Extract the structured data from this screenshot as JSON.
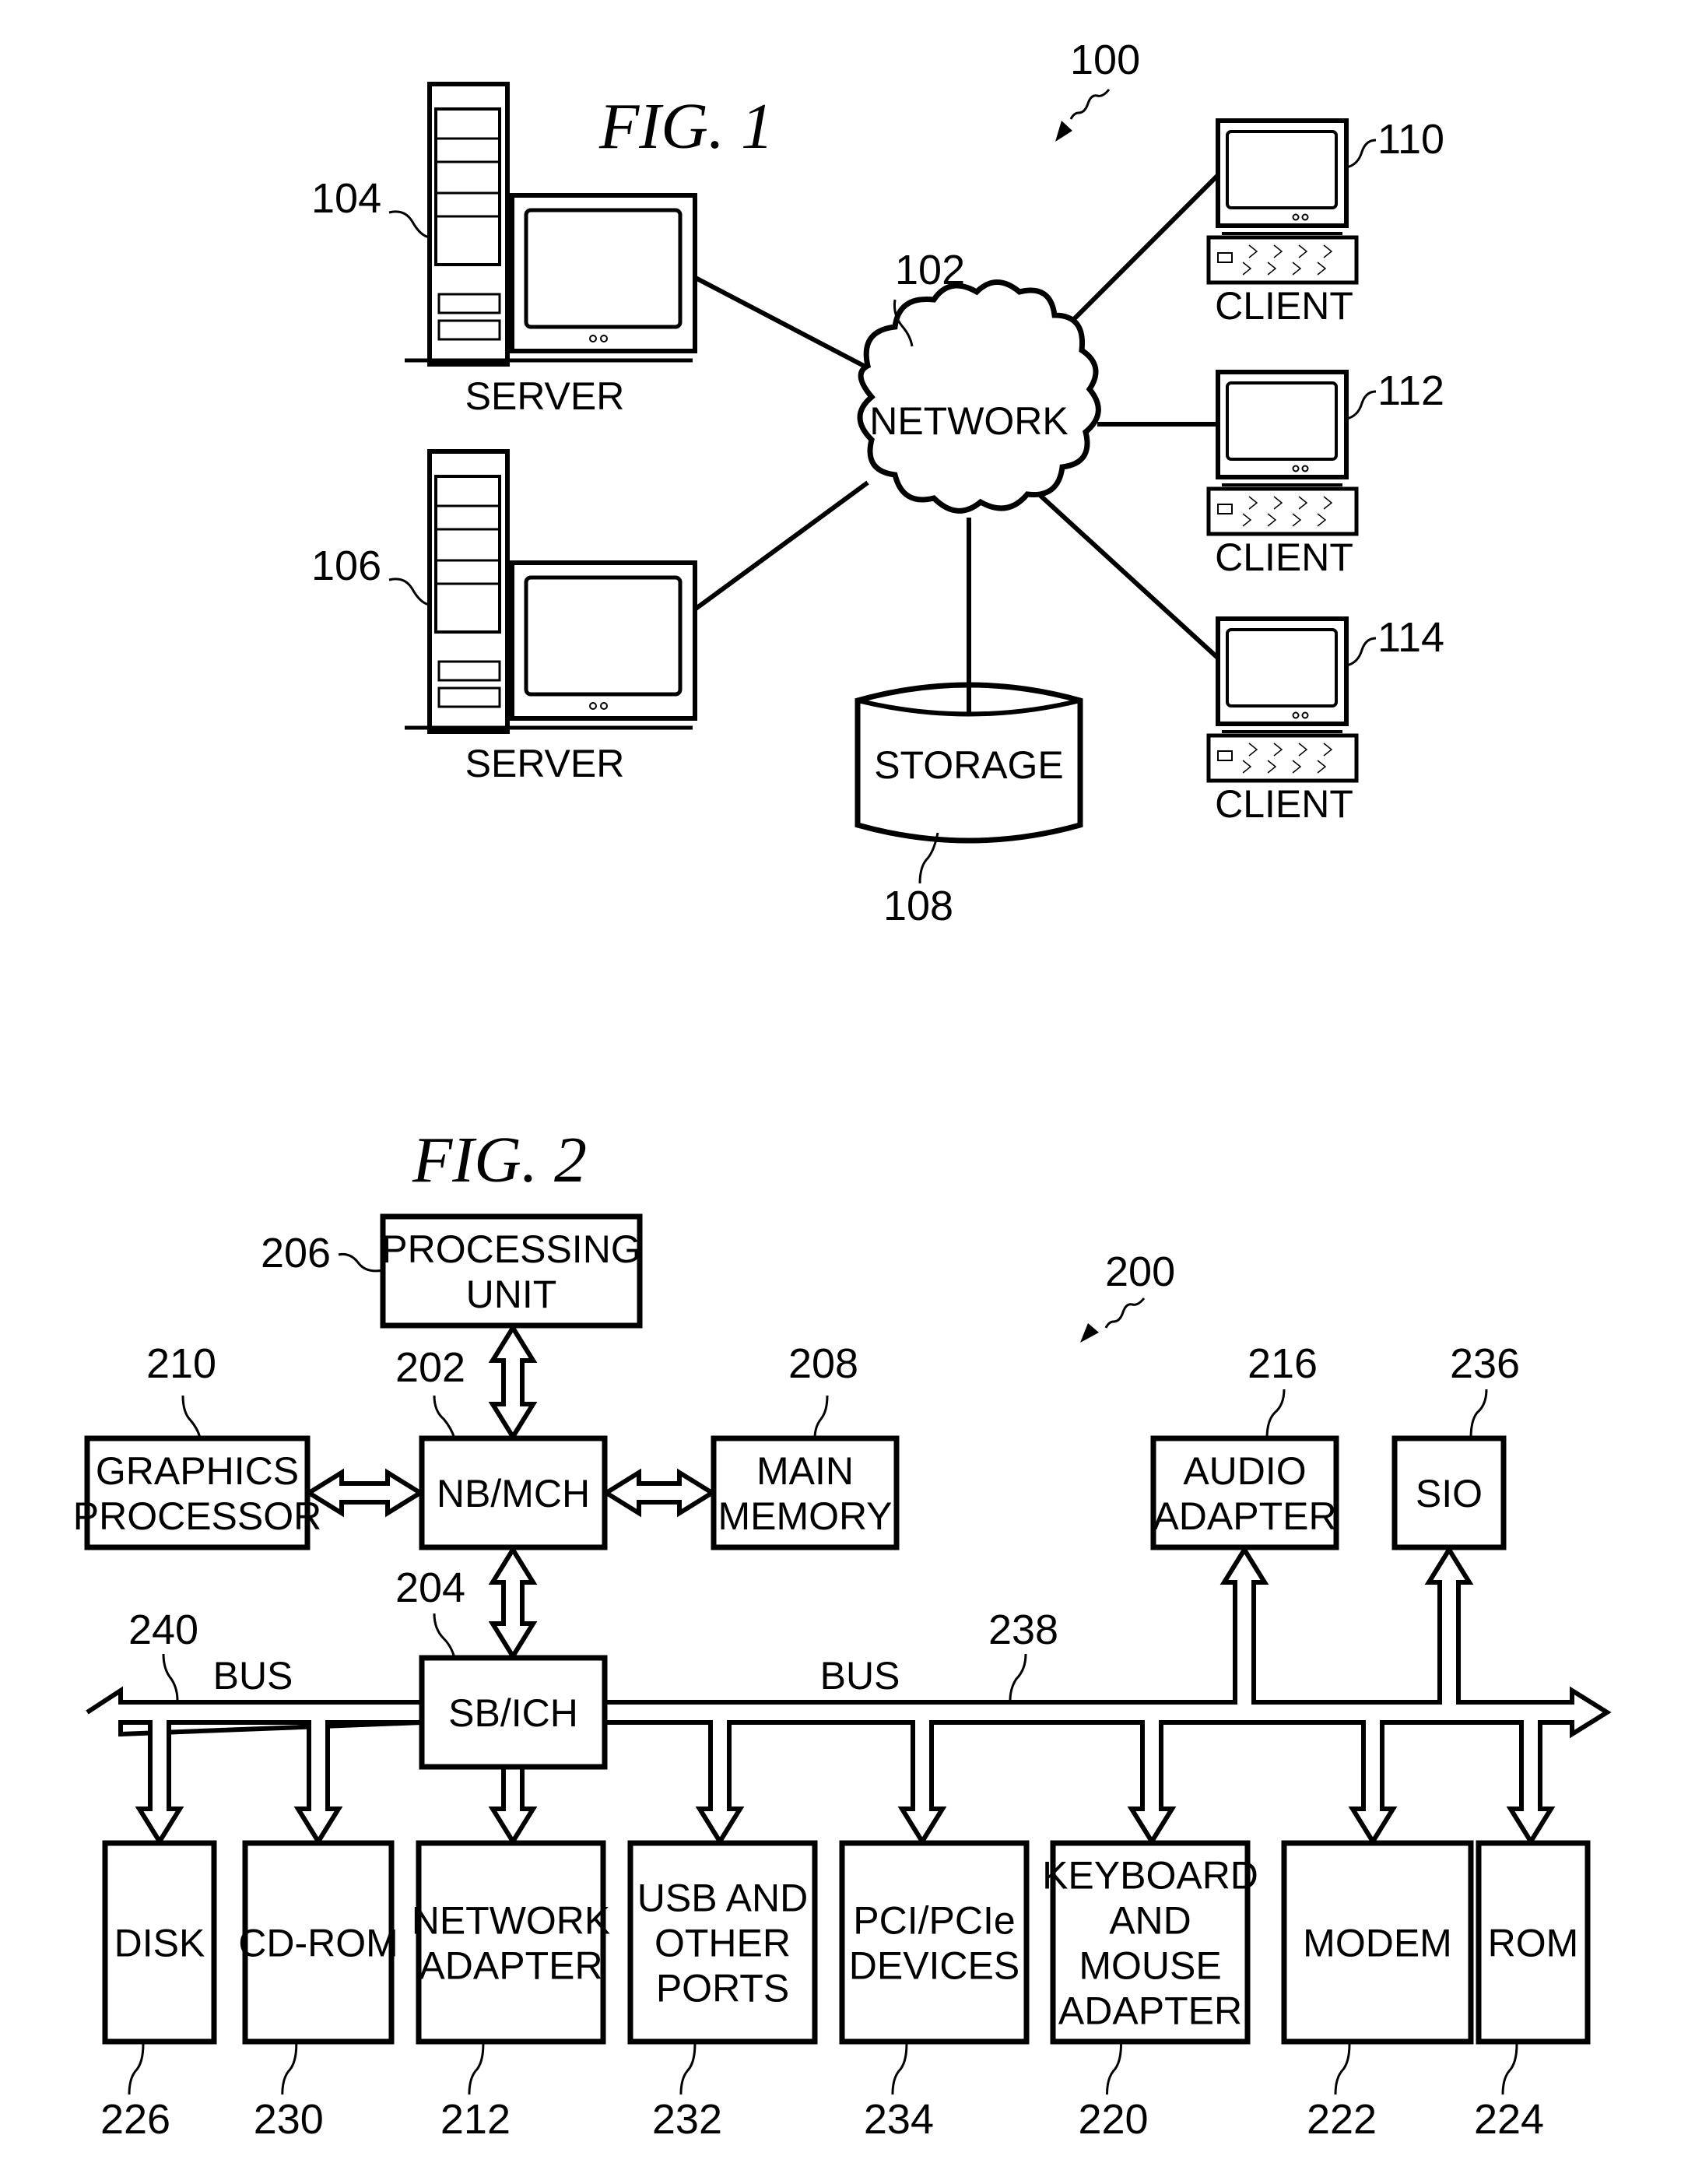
{
  "fig1": {
    "title": "FIG. 1",
    "ref": "100",
    "network": {
      "label": "NETWORK",
      "ref": "102"
    },
    "storage": {
      "label": "STORAGE",
      "ref": "108"
    },
    "servers": [
      {
        "label": "SERVER",
        "ref": "104"
      },
      {
        "label": "SERVER",
        "ref": "106"
      }
    ],
    "clients": [
      {
        "label": "CLIENT",
        "ref": "110"
      },
      {
        "label": "CLIENT",
        "ref": "112"
      },
      {
        "label": "CLIENT",
        "ref": "114"
      }
    ]
  },
  "fig2": {
    "title": "FIG. 2",
    "ref": "200",
    "processing_unit": {
      "lines": [
        "PROCESSING",
        "UNIT"
      ],
      "ref": "206"
    },
    "nb_mch": {
      "lines": [
        "NB/MCH"
      ],
      "ref": "202"
    },
    "graphics_processor": {
      "lines": [
        "GRAPHICS",
        "PROCESSOR"
      ],
      "ref": "210"
    },
    "main_memory": {
      "lines": [
        "MAIN",
        "MEMORY"
      ],
      "ref": "208"
    },
    "sb_ich": {
      "lines": [
        "SB/ICH"
      ],
      "ref": "204"
    },
    "audio_adapter": {
      "lines": [
        "AUDIO",
        "ADAPTER"
      ],
      "ref": "216"
    },
    "sio": {
      "lines": [
        "SIO"
      ],
      "ref": "236"
    },
    "bus_left": {
      "label": "BUS",
      "ref": "240"
    },
    "bus_right": {
      "label": "BUS",
      "ref": "238"
    },
    "devices": [
      {
        "lines": [
          "DISK"
        ],
        "ref": "226"
      },
      {
        "lines": [
          "CD-ROM"
        ],
        "ref": "230"
      },
      {
        "lines": [
          "NETWORK",
          "ADAPTER"
        ],
        "ref": "212"
      },
      {
        "lines": [
          "USB AND",
          "OTHER",
          "PORTS"
        ],
        "ref": "232"
      },
      {
        "lines": [
          "PCI/PCIe",
          "DEVICES"
        ],
        "ref": "234"
      },
      {
        "lines": [
          "KEYBOARD",
          "AND",
          "MOUSE",
          "ADAPTER"
        ],
        "ref": "220"
      },
      {
        "lines": [
          "MODEM"
        ],
        "ref": "222"
      },
      {
        "lines": [
          "ROM"
        ],
        "ref": "224"
      }
    ]
  }
}
